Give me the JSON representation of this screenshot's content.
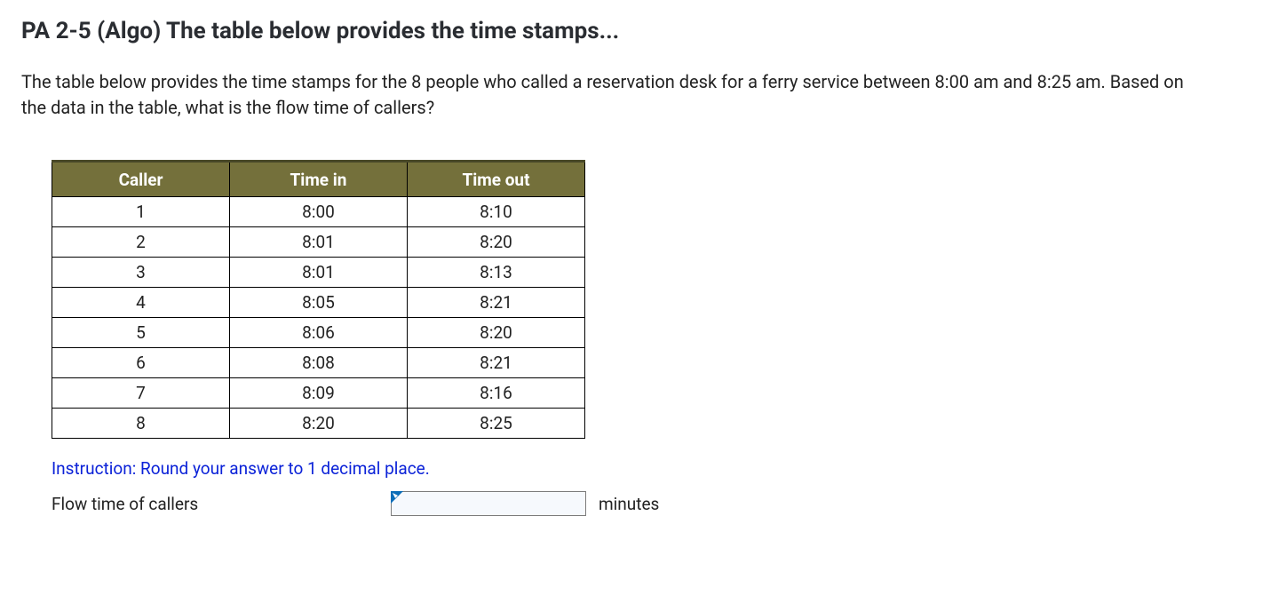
{
  "title": "PA 2-5 (Algo) The table below provides the time stamps...",
  "description": "The table below provides the time stamps for the 8 people who called a reservation desk for a ferry service between 8:00 am and 8:25 am. Based on the data in the table, what is the flow time of callers?",
  "table": {
    "headers": {
      "caller": "Caller",
      "time_in": "Time in",
      "time_out": "Time out"
    },
    "rows": [
      {
        "caller": "1",
        "time_in": "8:00",
        "time_out": "8:10"
      },
      {
        "caller": "2",
        "time_in": "8:01",
        "time_out": "8:20"
      },
      {
        "caller": "3",
        "time_in": "8:01",
        "time_out": "8:13"
      },
      {
        "caller": "4",
        "time_in": "8:05",
        "time_out": "8:21"
      },
      {
        "caller": "5",
        "time_in": "8:06",
        "time_out": "8:20"
      },
      {
        "caller": "6",
        "time_in": "8:08",
        "time_out": "8:21"
      },
      {
        "caller": "7",
        "time_in": "8:09",
        "time_out": "8:16"
      },
      {
        "caller": "8",
        "time_in": "8:20",
        "time_out": "8:25"
      }
    ]
  },
  "instruction": "Instruction: Round your answer to 1 decimal place.",
  "answer": {
    "label": "Flow time of callers",
    "value": "",
    "placeholder": "",
    "unit": "minutes"
  }
}
